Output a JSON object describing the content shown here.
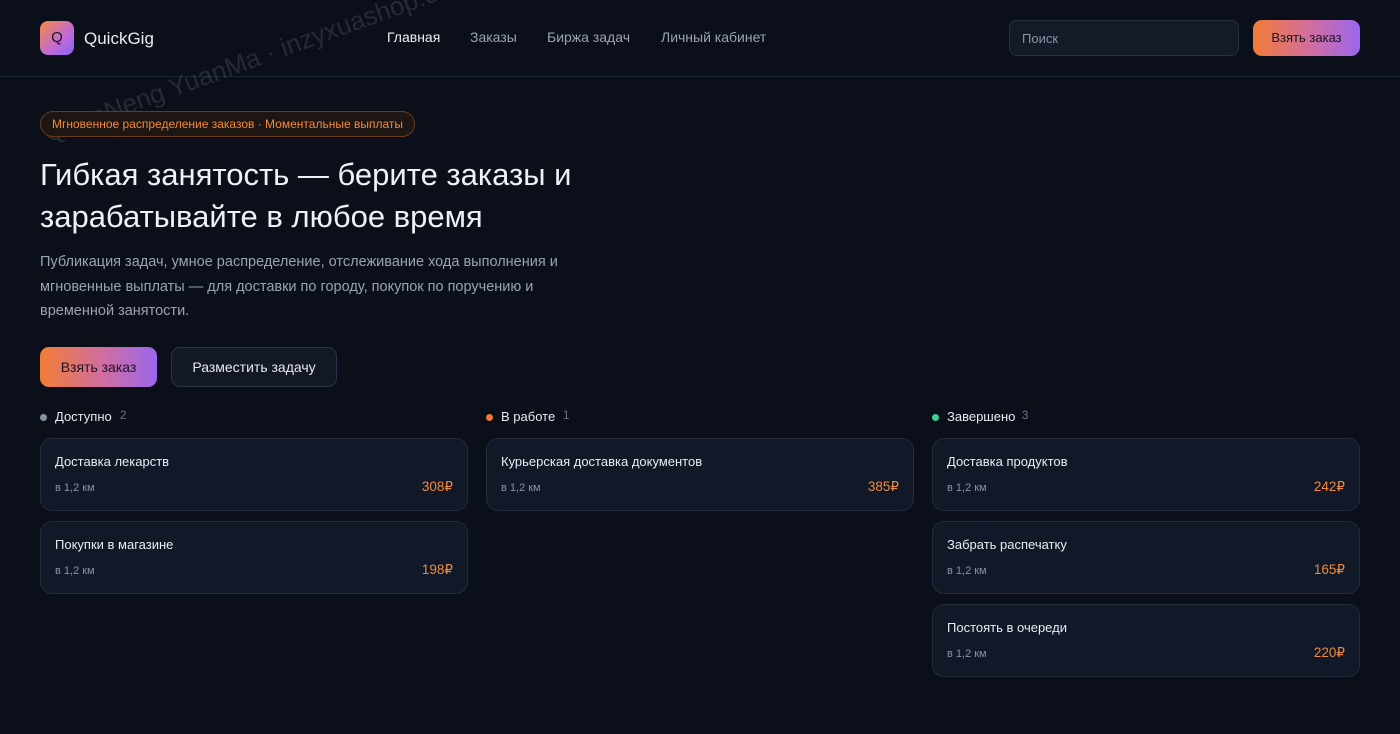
{
  "header": {
    "logo_letter": "Q",
    "app_name": "QuickGig",
    "nav": [
      {
        "label": "Главная",
        "active": true
      },
      {
        "label": "Заказы",
        "active": false
      },
      {
        "label": "Биржа задач",
        "active": false
      },
      {
        "label": "Личный кабинет",
        "active": false
      }
    ],
    "search_placeholder": "Поиск",
    "cta_label": "Взять заказ"
  },
  "hero": {
    "badge": "Мгновенное распределение заказов · Моментальные выплаты",
    "title": "Гибкая занятость — берите заказы и зарабатывайте в любое время",
    "description": "Публикация задач, умное распределение, отслеживание хода выполнения и мгновенные выплаты — для доставки по городу, покупок по поручению и временной занятости.",
    "primary_button": "Взять заказ",
    "secondary_button": "Разместить задачу"
  },
  "columns": [
    {
      "title": "Доступно",
      "count": "2",
      "dot_color": "#8a93a4",
      "cards": [
        {
          "title": "Доставка лекарств",
          "distance": "в 1,2 км",
          "price": "308₽"
        },
        {
          "title": "Покупки в магазине",
          "distance": "в 1,2 км",
          "price": "198₽"
        }
      ]
    },
    {
      "title": "В работе",
      "count": "1",
      "dot_color": "#f0783a",
      "cards": [
        {
          "title": "Курьерская доставка документов",
          "distance": "в 1,2 км",
          "price": "385₽"
        }
      ]
    },
    {
      "title": "Завершено",
      "count": "3",
      "dot_color": "#3ccf8e",
      "cards": [
        {
          "title": "Доставка продуктов",
          "distance": "в 1,2 км",
          "price": "242₽"
        },
        {
          "title": "Забрать распечатку",
          "distance": "в 1,2 км",
          "price": "165₽"
        },
        {
          "title": "Постоять в очереди",
          "distance": "в 1,2 км",
          "price": "220₽"
        }
      ]
    }
  ],
  "watermark": "QuanNeng YuanMa · inzyxuashop.com",
  "colors": {
    "background": "#0a0f1a",
    "accent_orange": "#f08a3e",
    "accent_purple": "#9a67ee",
    "card_bg": "#111827"
  }
}
